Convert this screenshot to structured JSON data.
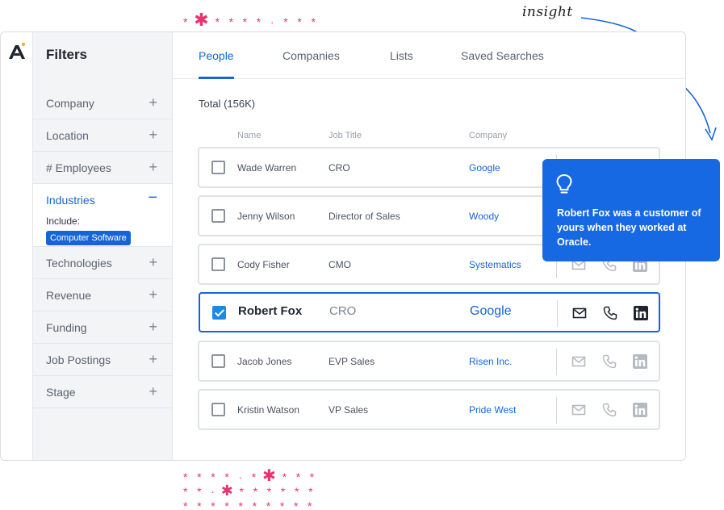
{
  "filters": {
    "title": "Filters",
    "items": [
      {
        "label": "Company"
      },
      {
        "label": "Location"
      },
      {
        "label": "# Employees"
      },
      {
        "label": "Industries",
        "active": true,
        "include_label": "Include:",
        "chip": "Computer Software"
      },
      {
        "label": "Technologies"
      },
      {
        "label": "Revenue"
      },
      {
        "label": "Funding"
      },
      {
        "label": "Job Postings"
      },
      {
        "label": "Stage"
      }
    ]
  },
  "tabs": [
    "People",
    "Companies",
    "Lists",
    "Saved Searches"
  ],
  "active_tab": "People",
  "total": "Total (156K)",
  "columns": {
    "name": "Name",
    "job_title": "Job Title",
    "company": "Company"
  },
  "rows": [
    {
      "name": "Wade Warren",
      "title": "CRO",
      "company": "Google",
      "checked": false
    },
    {
      "name": "Jenny Wilson",
      "title": "Director of Sales",
      "company": "Woody",
      "checked": false
    },
    {
      "name": "Cody Fisher",
      "title": "CMO",
      "company": "Systematics",
      "checked": false
    },
    {
      "name": "Robert Fox",
      "title": "CRO",
      "company": "Google",
      "checked": true
    },
    {
      "name": "Jacob Jones",
      "title": "EVP Sales",
      "company": "Risen Inc.",
      "checked": false
    },
    {
      "name": "Kristin Watson",
      "title": "VP Sales",
      "company": "Pride West",
      "checked": false
    }
  ],
  "insight": {
    "label": "insight",
    "text": "Robert Fox was a customer of yours when they worked at Oracle.",
    "icon": "lightbulb-icon"
  },
  "colors": {
    "accent": "#1565d8",
    "card": "#1668e3",
    "stars": "#e8336f"
  }
}
